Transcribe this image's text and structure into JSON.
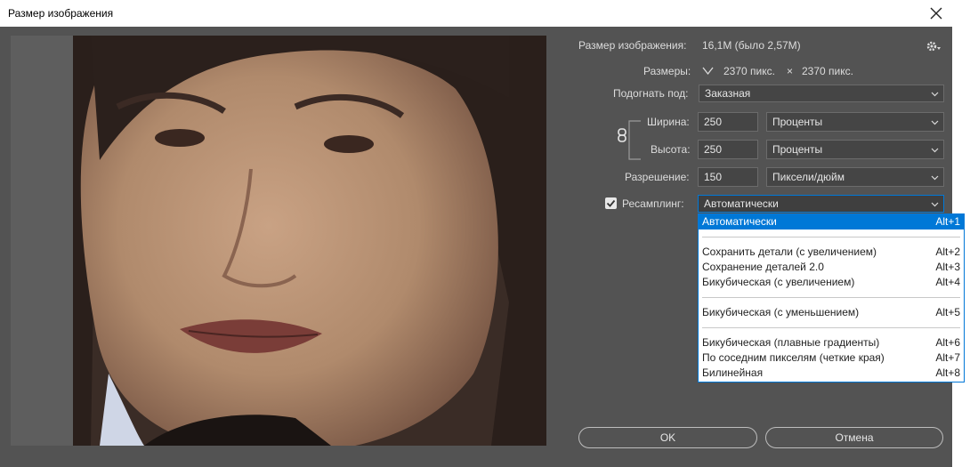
{
  "window": {
    "title": "Размер изображения"
  },
  "info": {
    "image_size_label": "Размер изображения:",
    "image_size_value": "16,1M (было 2,57M)",
    "dimensions_label": "Размеры:",
    "dim_width": "2370 пикс.",
    "dim_sep": "×",
    "dim_height": "2370 пикс."
  },
  "fit": {
    "label": "Подогнать под:",
    "value": "Заказная"
  },
  "width": {
    "label": "Ширина:",
    "value": "250",
    "unit": "Проценты"
  },
  "height": {
    "label": "Высота:",
    "value": "250",
    "unit": "Проценты"
  },
  "resolution": {
    "label": "Разрешение:",
    "value": "150",
    "unit": "Пиксели/дюйм"
  },
  "resample": {
    "label": "Ресамплинг:",
    "checked": true,
    "value": "Автоматически"
  },
  "dropdown": {
    "items": [
      {
        "label": "Автоматически",
        "shortcut": "Alt+1",
        "selected": true
      },
      {
        "label": "Сохранить детали (с увеличением)",
        "shortcut": "Alt+2"
      },
      {
        "label": "Сохранение деталей 2.0",
        "shortcut": "Alt+3"
      },
      {
        "label": "Бикубическая (с увеличением)",
        "shortcut": "Alt+4"
      },
      {
        "label": "Бикубическая (с уменьшением)",
        "shortcut": "Alt+5"
      },
      {
        "label": "Бикубическая (плавные градиенты)",
        "shortcut": "Alt+6"
      },
      {
        "label": "По соседним пикселям (четкие края)",
        "shortcut": "Alt+7"
      },
      {
        "label": "Билинейная",
        "shortcut": "Alt+8"
      }
    ]
  },
  "buttons": {
    "ok": "OK",
    "cancel": "Отмена"
  },
  "colors": {
    "accent": "#0078d7",
    "panel": "#535353",
    "field": "#454545"
  }
}
